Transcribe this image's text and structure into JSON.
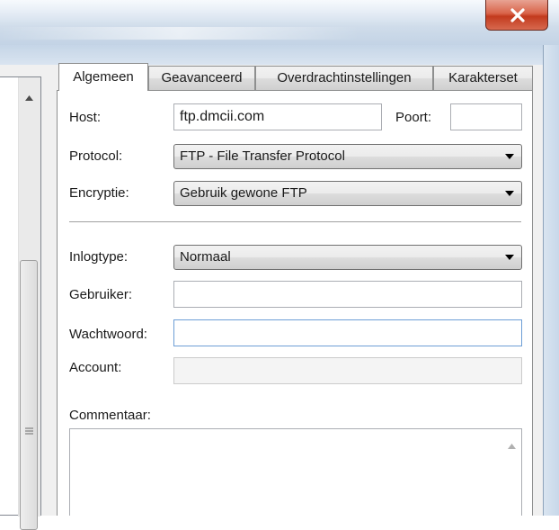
{
  "window": {
    "close_icon": "close-x-icon"
  },
  "left_panel": {
    "scroll_up_icon": "scroll-up-arrow-icon",
    "grip_icon": "scroll-grip-icon"
  },
  "tabs": [
    {
      "label": "Algemeen",
      "active": true
    },
    {
      "label": "Geavanceerd",
      "active": false
    },
    {
      "label": "Overdrachtinstellingen",
      "active": false
    },
    {
      "label": "Karakterset",
      "active": false
    }
  ],
  "form": {
    "host_label": "Host:",
    "host_value": "ftp.dmcii.com",
    "port_label": "Poort:",
    "port_value": "",
    "protocol_label": "Protocol:",
    "protocol_value": "FTP - File Transfer Protocol",
    "encryption_label": "Encryptie:",
    "encryption_value": "Gebruik gewone FTP",
    "logontype_label": "Inlogtype:",
    "logontype_value": "Normaal",
    "user_label": "Gebruiker:",
    "user_value": "",
    "password_label": "Wachtwoord:",
    "password_value": "",
    "account_label": "Account:",
    "account_value": "",
    "comments_label": "Commentaar:",
    "comments_value": ""
  },
  "colors": {
    "focus_border": "#6d9ed6",
    "close_button": "#c9452a"
  }
}
